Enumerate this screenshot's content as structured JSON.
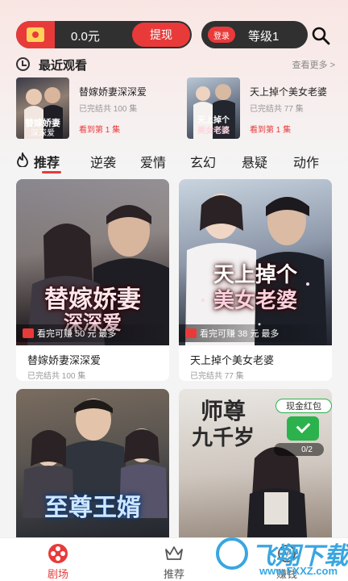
{
  "header": {
    "wallet_amount": "0.0元",
    "withdraw_label": "提现",
    "login_label": "登录",
    "level_label": "等级1"
  },
  "recent": {
    "title": "最近观看",
    "more_label": "查看更多 >",
    "items": [
      {
        "name": "替嫁娇妻深深爱",
        "status": "已完结共 100 集",
        "progress": "看到第 1 集",
        "cover_text": "替嫁娇妻深深爱"
      },
      {
        "name": "天上掉个美女老婆",
        "status": "已完结共 77 集",
        "progress": "看到第 1 集",
        "cover_text": "天上掉个美女老婆"
      }
    ]
  },
  "tabs": [
    "推荐",
    "逆袭",
    "爱情",
    "玄幻",
    "悬疑",
    "动作"
  ],
  "cards": [
    {
      "title": "替嫁娇妻深深爱",
      "status": "已完结共 100 集",
      "earn": "看完可赚 50 元 最多",
      "cover_line1": "替嫁娇妻",
      "cover_line2": "深深爱"
    },
    {
      "title": "天上掉个美女老婆",
      "status": "已完结共 77 集",
      "earn": "看完可赚 38 元 最多",
      "cover_line1": "天上掉个",
      "cover_line2": "美女老婆"
    },
    {
      "title": "",
      "status": "",
      "earn": "",
      "cover_line1": "至尊王婿",
      "cover_line2": ""
    },
    {
      "title": "",
      "status": "",
      "earn": "",
      "cover_line1": "师尊",
      "cover_line2": "九千岁"
    }
  ],
  "cash_box": {
    "label": "现金红包",
    "pager": "0/2"
  },
  "bottom_nav": [
    {
      "label": "剧场",
      "icon": "film-reel-icon"
    },
    {
      "label": "推荐",
      "icon": "crown-icon"
    },
    {
      "label": "赚钱",
      "icon": "coin-icon"
    }
  ],
  "watermark": {
    "brand": "飞翔下载",
    "url": "www.FXXZ.com"
  },
  "colors": {
    "accent": "#e93a3a",
    "dark_pill": "#303030",
    "green": "#2bb24c"
  }
}
